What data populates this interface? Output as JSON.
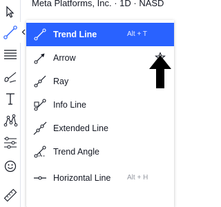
{
  "header": {
    "symbol_text": "Meta Platforms, Inc. · 1D · NASD"
  },
  "toolbar": {
    "tools": [
      "cursor-icon",
      "trend-line-tool-icon",
      "fib-tool-icon",
      "brush-tool-icon",
      "text-tool-icon",
      "pattern-tool-icon",
      "prediction-tool-icon",
      "emoji-icon",
      "ruler-icon"
    ]
  },
  "menu": {
    "items": [
      {
        "label": "Trend Line",
        "shortcut": "Alt + T",
        "selected": true
      },
      {
        "label": "Arrow",
        "shortcut": "",
        "favorite": false
      },
      {
        "label": "Ray",
        "shortcut": ""
      },
      {
        "label": "Info Line",
        "shortcut": ""
      },
      {
        "label": "Extended Line",
        "shortcut": ""
      },
      {
        "label": "Trend Angle",
        "shortcut": ""
      },
      {
        "label": "Horizontal Line",
        "shortcut": "Alt + H"
      }
    ]
  },
  "colors": {
    "accent": "#2962ff",
    "text": "#131722",
    "muted": "#9598a1"
  }
}
